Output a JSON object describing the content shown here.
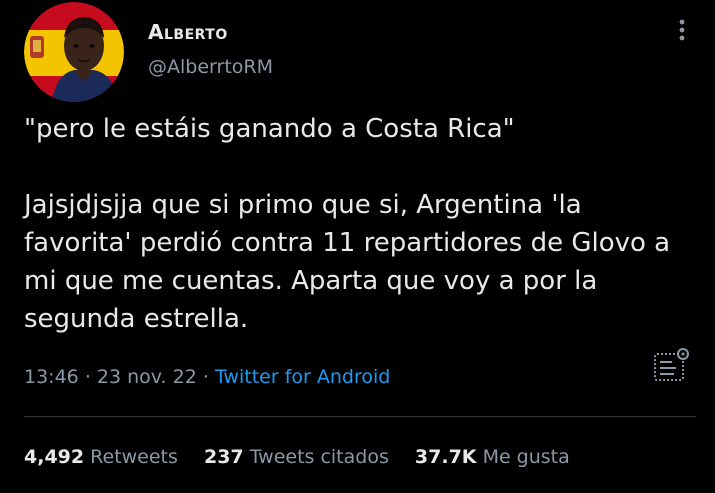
{
  "author": {
    "name": "Alberto",
    "handle": "@AlberrtoRM"
  },
  "tweet": {
    "paragraphs": [
      "\"pero le estáis ganando a Costa Rica\"",
      "Jajsjdjsjja que si primo que si, Argentina 'la favorita' perdió contra 11 repartidores de Glovo a mi que me cuentas. Aparta que voy a por la segunda estrella."
    ]
  },
  "meta": {
    "time": "13:46",
    "separator1": "·",
    "date": "23 nov. 22",
    "separator2": "·",
    "source": "Twitter for Android"
  },
  "stats": {
    "retweets_count": "4,492",
    "retweets_label": "Retweets",
    "quotes_count": "237",
    "quotes_label": "Tweets citados",
    "likes_count": "37.7K",
    "likes_label": "Me gusta"
  },
  "icons": {
    "more": "more-vertical-icon",
    "analytics": "analytics-icon"
  },
  "colors": {
    "background": "#000000",
    "text_primary": "#e7e9ea",
    "text_secondary": "#8b98a5",
    "link": "#1d9bf0",
    "divider": "#2f3336"
  }
}
